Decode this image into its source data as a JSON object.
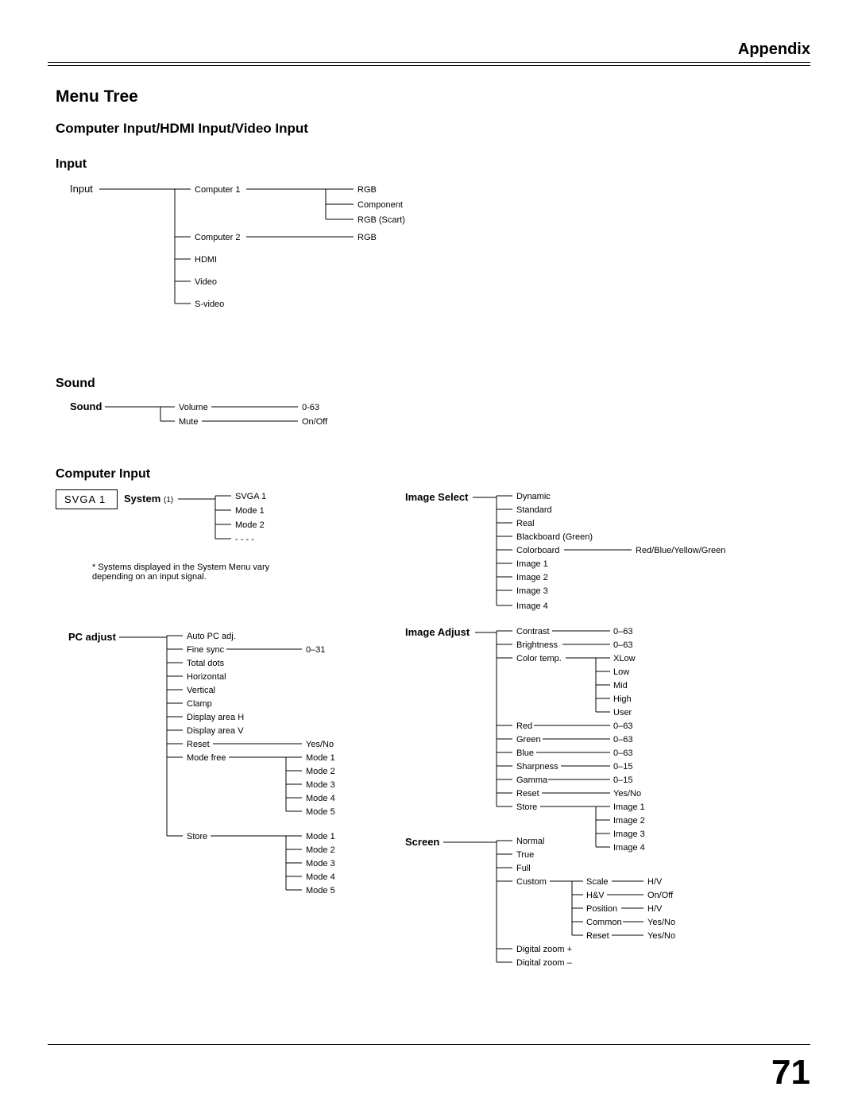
{
  "header": {
    "appendix": "Appendix"
  },
  "titles": {
    "menu_tree": "Menu Tree",
    "subtitle": "Computer Input/HDMI Input/Video Input",
    "input": "Input",
    "sound": "Sound",
    "computer_input": "Computer Input"
  },
  "input_tree": {
    "root": "Input",
    "comp1": "Computer 1",
    "comp1_rgb": "RGB",
    "comp1_component": "Component",
    "comp1_rgb_scart": "RGB (Scart)",
    "comp2": "Computer 2",
    "comp2_rgb": "RGB",
    "hdmi": "HDMI",
    "video": "Video",
    "svideo": "S-video"
  },
  "sound_tree": {
    "root": "Sound",
    "volume": "Volume",
    "volume_range": "0-63",
    "mute": "Mute",
    "mute_val": "On/Off"
  },
  "system_box": "SVGA 1",
  "system_tree": {
    "label": "System",
    "label_sub": "(1)",
    "svga1": "SVGA 1",
    "mode1": "Mode 1",
    "mode2": "Mode 2",
    "dots": "- - - -"
  },
  "system_note": "* Systems displayed in the System Menu vary depending on an input signal.",
  "pc_adjust": {
    "root": "PC adjust",
    "auto": "Auto PC adj.",
    "finesync": "Fine sync",
    "finesync_range": "0–31",
    "totaldots": "Total dots",
    "horizontal": "Horizontal",
    "vertical": "Vertical",
    "clamp": "Clamp",
    "display_h": "Display area H",
    "display_v": "Display area V",
    "reset": "Reset",
    "reset_yn": "Yes/No",
    "modefree": "Mode free",
    "mf1": "Mode 1",
    "mf2": "Mode 2",
    "mf3": "Mode 3",
    "mf4": "Mode 4",
    "mf5": "Mode 5",
    "store": "Store",
    "st1": "Mode 1",
    "st2": "Mode 2",
    "st3": "Mode 3",
    "st4": "Mode 4",
    "st5": "Mode 5"
  },
  "image_select": {
    "root": "Image Select",
    "dynamic": "Dynamic",
    "standard": "Standard",
    "real": "Real",
    "blackboard": "Blackboard (Green)",
    "colorboard": "Colorboard",
    "colorboard_opts": "Red/Blue/Yellow/Green",
    "image1": "Image 1",
    "image2": "Image 2",
    "image3": "Image 3",
    "image4": "Image 4"
  },
  "image_adjust": {
    "root": "Image Adjust",
    "contrast": "Contrast",
    "contrast_r": "0–63",
    "brightness": "Brightness",
    "brightness_r": "0–63",
    "colortemp": "Color temp.",
    "ct_xlow": "XLow",
    "ct_low": "Low",
    "ct_mid": "Mid",
    "ct_high": "High",
    "ct_user": "User",
    "red": "Red",
    "red_r": "0–63",
    "green": "Green",
    "green_r": "0–63",
    "blue": "Blue",
    "blue_r": "0–63",
    "sharpness": "Sharpness",
    "sharpness_r": "0–15",
    "gamma": "Gamma",
    "gamma_r": "0–15",
    "reset": "Reset",
    "reset_r": "Yes/No",
    "store": "Store",
    "st_i1": "Image 1",
    "st_i2": "Image 2",
    "st_i3": "Image 3",
    "st_i4": "Image 4"
  },
  "screen": {
    "root": "Screen",
    "normal": "Normal",
    "true": "True",
    "full": "Full",
    "custom": "Custom",
    "scale": "Scale",
    "scale_v": "H/V",
    "hv": "H&V",
    "hv_v": "On/Off",
    "position": "Position",
    "pos_v": "H/V",
    "common": "Common",
    "common_v": "Yes/No",
    "reset": "Reset",
    "reset_v": "Yes/No",
    "dzp": "Digital zoom +",
    "dzm": "Digital zoom –"
  },
  "page": "71"
}
